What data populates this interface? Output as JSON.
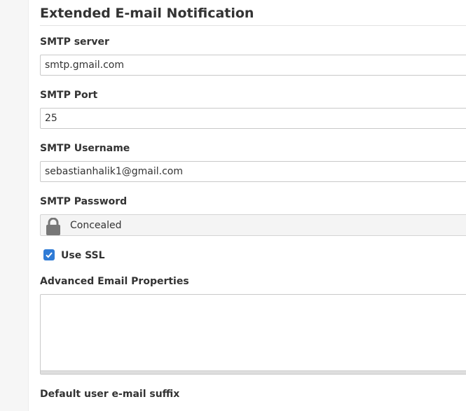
{
  "section": {
    "title": "Extended E-mail Notification"
  },
  "smtp_server": {
    "label": "SMTP server",
    "value": "smtp.gmail.com"
  },
  "smtp_port": {
    "label": "SMTP Port",
    "value": "25"
  },
  "smtp_username": {
    "label": "SMTP Username",
    "value": "sebastianhalik1@gmail.com"
  },
  "smtp_password": {
    "label": "SMTP Password",
    "status": "Concealed",
    "icon": "lock-icon"
  },
  "use_ssl": {
    "label": "Use SSL",
    "checked": true,
    "color": "#2f7bd6"
  },
  "advanced_properties": {
    "label": "Advanced Email Properties",
    "value": ""
  },
  "default_suffix": {
    "label": "Default user e-mail suffix"
  }
}
